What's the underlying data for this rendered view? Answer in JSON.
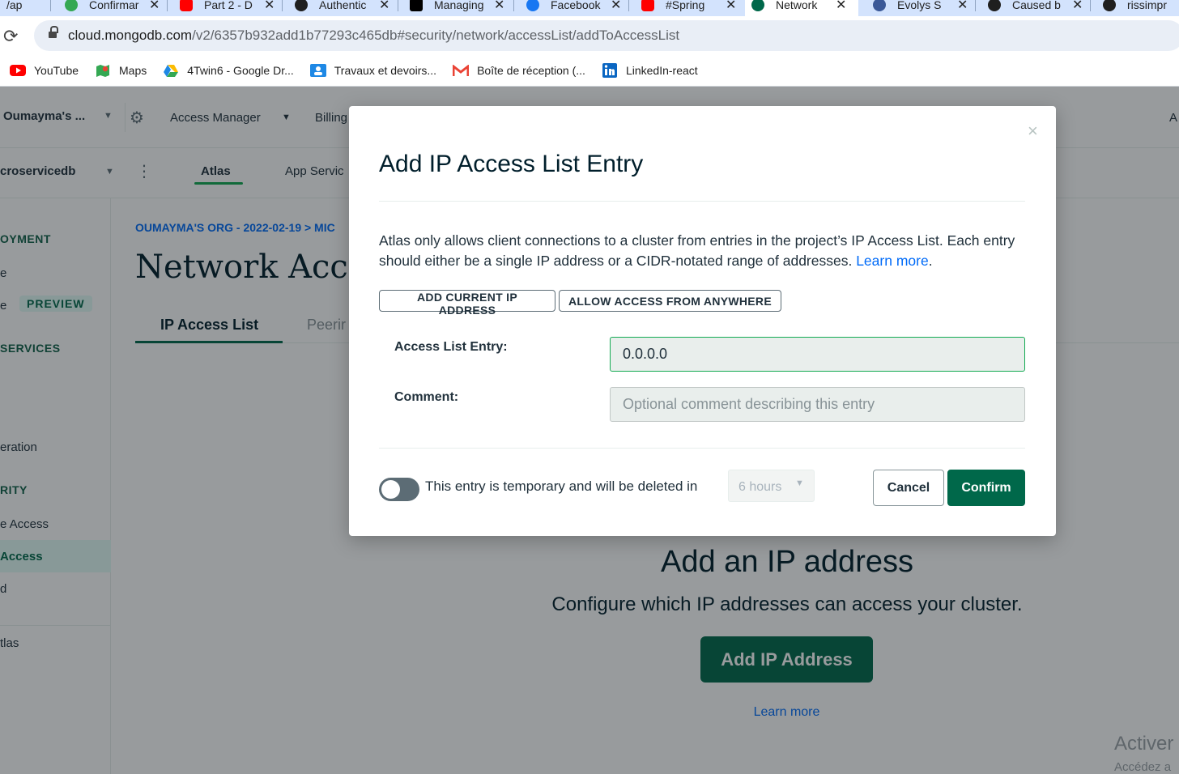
{
  "browser": {
    "tabs": [
      {
        "label": "/ap",
        "favicon_color": "#5f6368",
        "icon": "page-icon"
      },
      {
        "label": "Confirmar",
        "favicon_color": "#34a853",
        "icon": "leaf-icon"
      },
      {
        "label": "Part 2 - D",
        "favicon_color": "#ff0000",
        "icon": "youtube-icon"
      },
      {
        "label": "Authentic",
        "favicon_color": "#1f1f1f",
        "icon": "github-icon"
      },
      {
        "label": "Managing",
        "favicon_color": "#000000",
        "icon": "medium-icon"
      },
      {
        "label": "Facebook",
        "favicon_color": "#1877f2",
        "icon": "facebook-icon"
      },
      {
        "label": "#Spring",
        "favicon_color": "#ff0000",
        "icon": "youtube-icon"
      },
      {
        "label": "Network",
        "favicon_color": "#00684a",
        "icon": "mongodb-icon",
        "active": true
      },
      {
        "label": "Evolys S",
        "favicon_color": "#3b5998",
        "icon": "globe-icon"
      },
      {
        "label": "Caused b",
        "favicon_color": "#1f1f1f",
        "icon": "github-icon"
      },
      {
        "label": "rissimpr",
        "favicon_color": "#1f1f1f",
        "icon": "app-icon"
      }
    ],
    "url_host": "cloud.mongodb.com",
    "url_path": "/v2/6357b932add1b77293c465db#security/network/accessList/addToAccessList",
    "bookmarks": [
      {
        "label": "YouTube",
        "icon": "youtube-icon",
        "color": "#ff0000"
      },
      {
        "label": "Maps",
        "icon": "maps-icon",
        "color": "#34a853"
      },
      {
        "label": "4Twin6 - Google Dr...",
        "icon": "google-drive-icon",
        "color": "#fbbc04"
      },
      {
        "label": "Travaux et devoirs...",
        "icon": "classroom-icon",
        "color": "#1e88e5"
      },
      {
        "label": "Boîte de réception (...",
        "icon": "gmail-icon",
        "color": "#ea4335"
      },
      {
        "label": "LinkedIn-react",
        "icon": "linkedin-icon",
        "color": "#0a66c2"
      }
    ]
  },
  "atlas": {
    "org_name": "Oumayma's ...",
    "nav": {
      "access_manager": "Access Manager",
      "billing": "Billing",
      "right_cut": "A"
    },
    "project_name": "croservicedb",
    "product_tabs": {
      "atlas": "Atlas",
      "app_services": "App Servic"
    },
    "sidebar": [
      {
        "label": "OYMENT",
        "heading": true
      },
      {
        "label": "e",
        "heading": false
      },
      {
        "label": "e",
        "heading": false,
        "badge": "PREVIEW"
      },
      {
        "label": "SERVICES",
        "heading": true
      },
      {
        "label": "eration",
        "heading": false
      },
      {
        "label": "RITY",
        "heading": true
      },
      {
        "label": "e Access",
        "heading": false
      },
      {
        "label": "Access",
        "heading": false,
        "active": true
      },
      {
        "label": "d",
        "heading": false
      },
      {
        "label": "tlas",
        "heading": false
      }
    ],
    "breadcrumb": "OUMAYMA'S ORG - 2022-02-19 > MIC",
    "page_title": "Network Acce",
    "subtabs": {
      "ip_access_list": "IP Access List",
      "peering": "Peerir"
    },
    "empty_state": {
      "title": "Add an IP address",
      "subtitle": "Configure which IP addresses can access your cluster.",
      "button": "Add IP Address",
      "link": "Learn more"
    },
    "watermark": {
      "line1": "Activer",
      "line2": "Accédez a"
    }
  },
  "modal": {
    "title": "Add IP Access List Entry",
    "description": "Atlas only allows client connections to a cluster from entries in the project’s IP Access List. Each entry should either be a single IP address or a CIDR-notated range of addresses.",
    "learn_more": "Learn more",
    "learn_more_suffix": ".",
    "add_current_ip": "ADD CURRENT IP ADDRESS",
    "allow_anywhere": "ALLOW ACCESS FROM ANYWHERE",
    "entry_label": "Access List Entry:",
    "entry_value": "0.0.0.0",
    "comment_label": "Comment:",
    "comment_placeholder": "Optional comment describing this entry",
    "temporary_text": "This entry is temporary and will be deleted in",
    "temporary_toggle_on": false,
    "duration_value": "6 hours",
    "cancel": "Cancel",
    "confirm": "Confirm",
    "close_symbol": "×"
  },
  "colors": {
    "primary_green": "#00684a",
    "link_blue": "#016bf8",
    "focus_green": "#13aa52"
  }
}
